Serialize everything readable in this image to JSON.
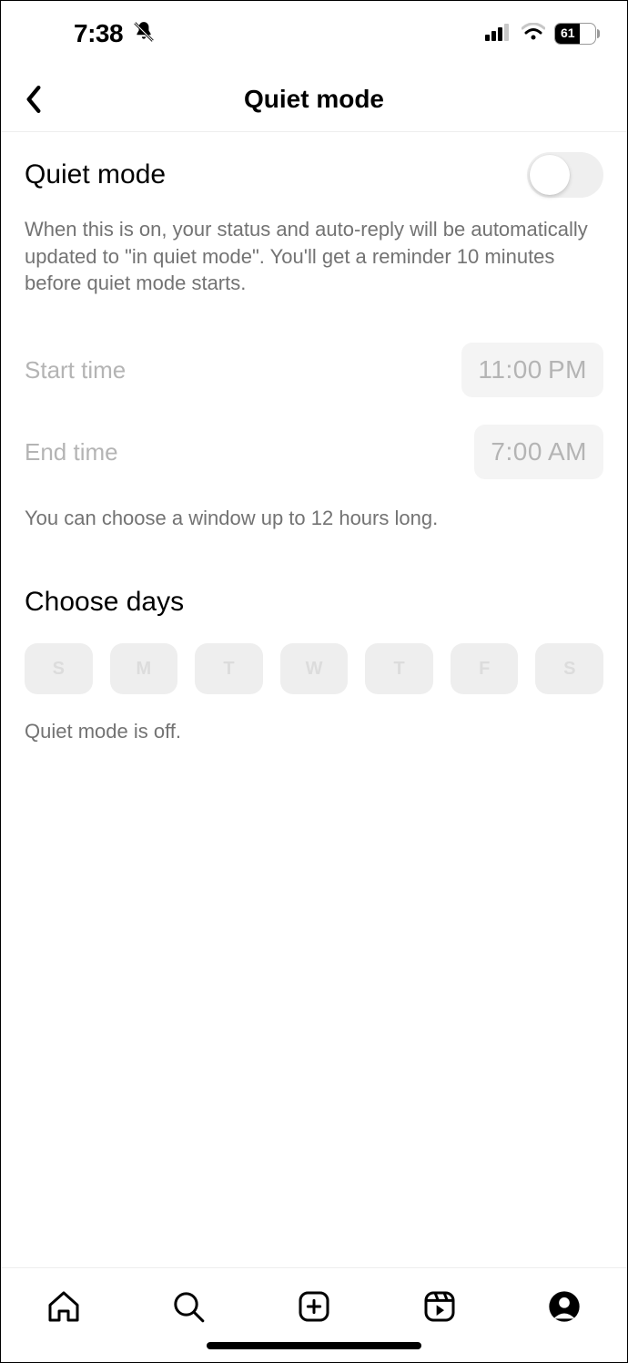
{
  "statusBar": {
    "time": "7:38",
    "battery": "61"
  },
  "header": {
    "title": "Quiet mode"
  },
  "toggle": {
    "label": "Quiet mode",
    "on": false
  },
  "description": "When this is on, your status and auto-reply will be automatically updated to \"in quiet mode\". You'll get a reminder 10 minutes before quiet mode starts.",
  "times": {
    "startLabel": "Start time",
    "startValue": "11:00 PM",
    "endLabel": "End time",
    "endValue": "7:00 AM",
    "helper": "You can choose a window up to 12 hours long."
  },
  "days": {
    "title": "Choose days",
    "items": [
      "S",
      "M",
      "T",
      "W",
      "T",
      "F",
      "S"
    ],
    "status": "Quiet mode is off."
  }
}
